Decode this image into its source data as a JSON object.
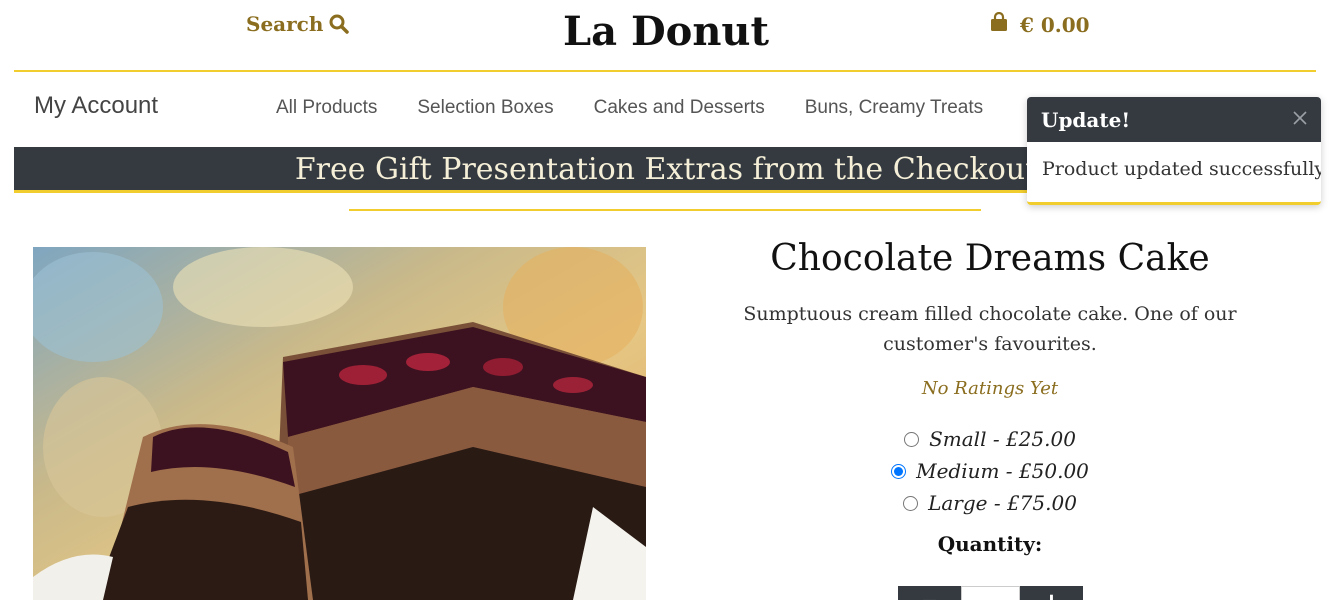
{
  "header": {
    "search_label": "Search",
    "brand": "La Donut",
    "cart_total": "€ 0.00"
  },
  "nav": {
    "account": "My Account",
    "items": [
      "All Products",
      "Selection Boxes",
      "Cakes and Desserts",
      "Buns, Creamy Treats"
    ]
  },
  "banner": {
    "text": "Free Gift Presentation Extras from the Checkout"
  },
  "toast": {
    "title": "Update!",
    "message": "Product updated successfully"
  },
  "product": {
    "name": "Chocolate Dreams Cake",
    "description": "Sumptuous cream filled chocolate cake. One of our customer's favourites.",
    "rating": "No Ratings Yet",
    "sizes": [
      {
        "label": "Small - £25.00",
        "selected": false
      },
      {
        "label": "Medium - £50.00",
        "selected": true
      },
      {
        "label": "Large - £75.00",
        "selected": false
      }
    ],
    "quantity_label": "Quantity:",
    "quantity_increment": "+",
    "quantity_decrement": "−"
  },
  "colors": {
    "accent_gold": "#f1cd2d",
    "brand_brown": "#8a6d1e",
    "dark_panel": "#343a40"
  },
  "icons": {
    "search": "search-icon",
    "cart": "shopping-bag-icon",
    "close": "close-icon"
  }
}
